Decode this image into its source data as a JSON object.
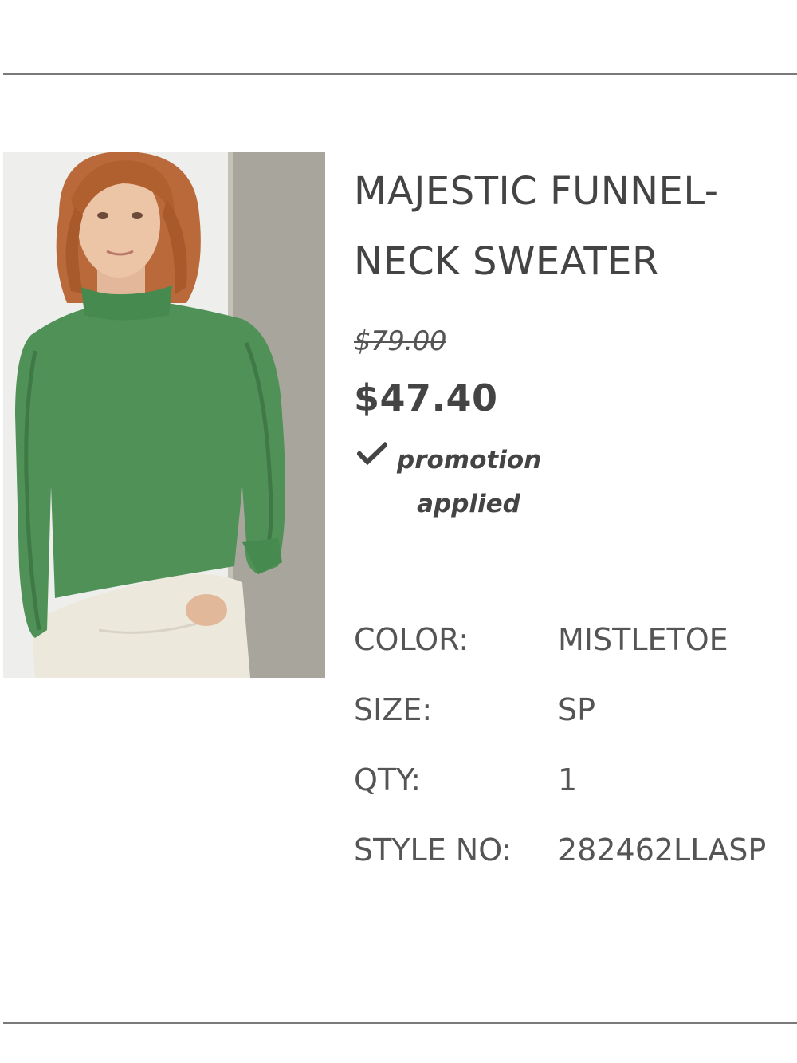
{
  "product": {
    "title_line1": "MAJESTIC FUNNEL-",
    "title_line2": "NECK SWEATER",
    "original_price": "$79.00",
    "sale_price": "$47.40",
    "promo_line1": "promotion",
    "promo_line2": "applied",
    "image_icon": "product-photo"
  },
  "details": {
    "color_label": "COLOR:",
    "color_value": "MISTLETOE",
    "size_label": "SIZE:",
    "size_value": "SP",
    "qty_label": "QTY:",
    "qty_value": "1",
    "style_label": "STYLE NO:",
    "style_value": "282462LLASP"
  },
  "colors": {
    "text": "#444444",
    "divider": "#7a7a7a",
    "sweater": "#4f9157"
  }
}
